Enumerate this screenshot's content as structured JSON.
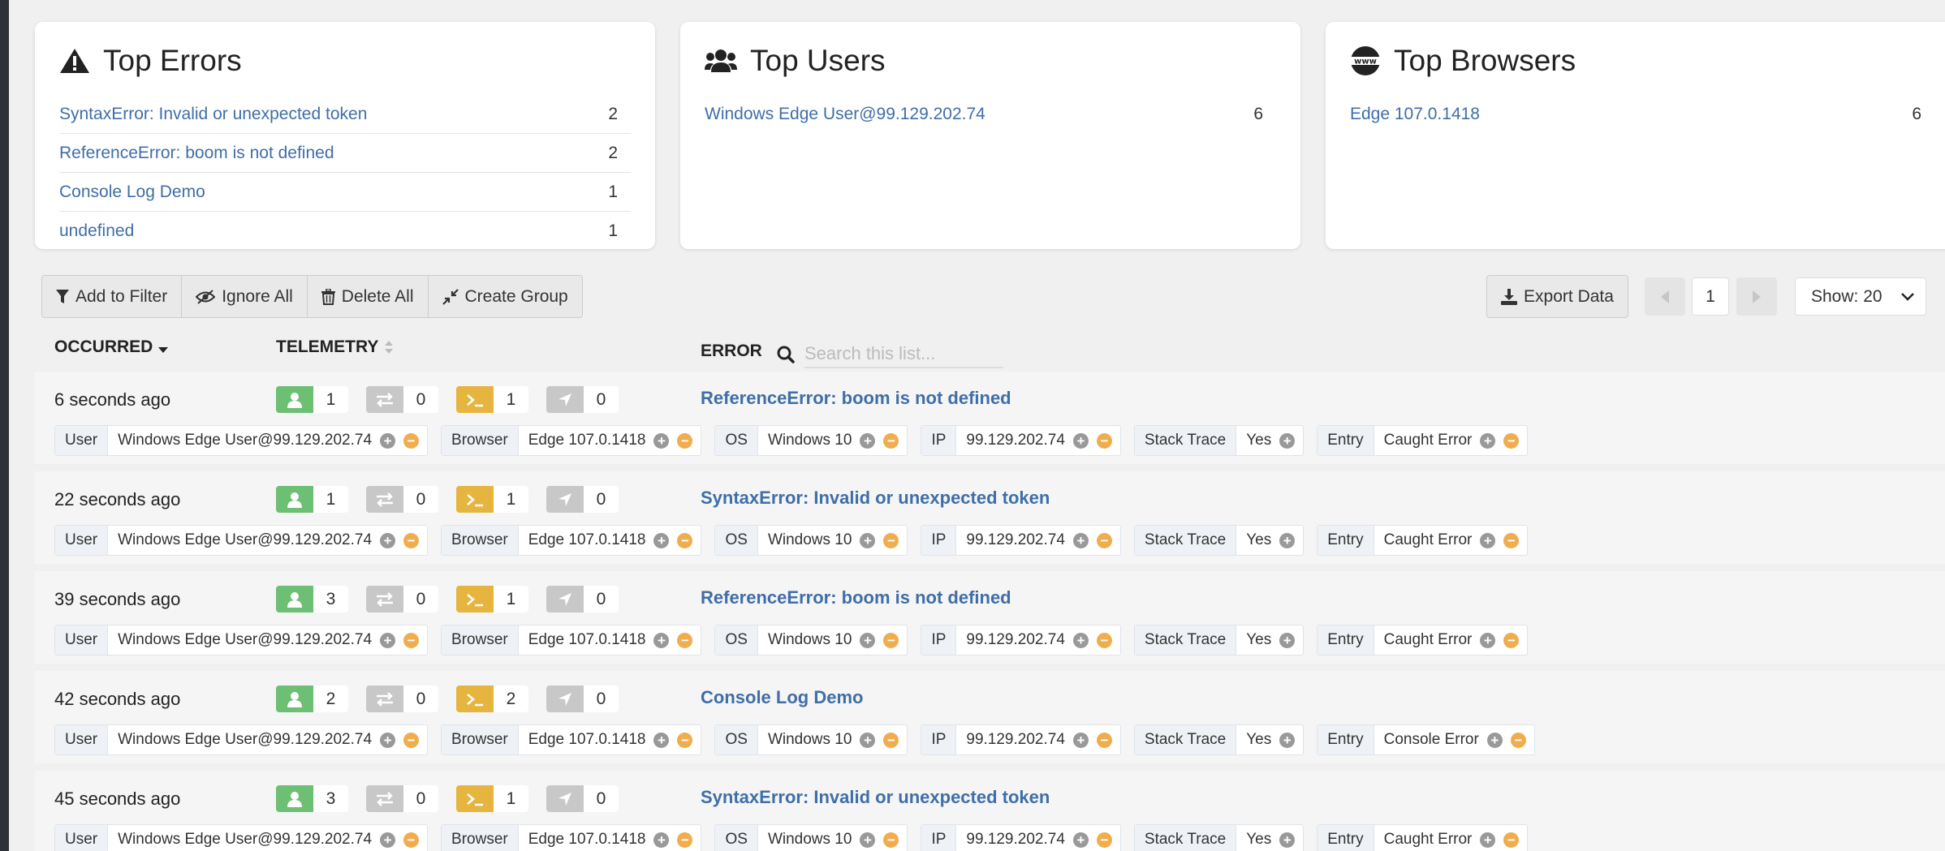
{
  "colors": {
    "link": "#3f6ea8",
    "user_badge": "#6cbf73",
    "nav_badge": "#c8c8c8",
    "console_badge": "#e6b540",
    "location_badge": "#c8c8c8",
    "minus": "#f0ad4e",
    "plus": "#999999"
  },
  "top_errors": {
    "title": "Top Errors",
    "icon": "warning-icon",
    "items": [
      {
        "label": "SyntaxError: Invalid or unexpected token",
        "count": "2"
      },
      {
        "label": "ReferenceError: boom is not defined",
        "count": "2"
      },
      {
        "label": "Console Log Demo",
        "count": "1"
      },
      {
        "label": "undefined",
        "count": "1"
      }
    ]
  },
  "top_users": {
    "title": "Top Users",
    "icon": "users-icon",
    "items": [
      {
        "label": "Windows Edge User@99.129.202.74",
        "count": "6"
      }
    ]
  },
  "top_browsers": {
    "title": "Top Browsers",
    "icon": "www-globe-icon",
    "items": [
      {
        "label": "Edge 107.0.1418",
        "count": "6"
      }
    ]
  },
  "toolbar": {
    "add_filter": "Add to Filter",
    "ignore_all": "Ignore All",
    "delete_all": "Delete All",
    "create_group": "Create Group",
    "export": "Export Data",
    "page": "1",
    "show": "Show: 20"
  },
  "table": {
    "col_occurred": "OCCURRED",
    "col_telemetry": "TELEMETRY",
    "col_error": "ERROR",
    "search_placeholder": "Search this list..."
  },
  "rows": [
    {
      "time": "6 seconds ago",
      "telemetry": [
        "1",
        "0",
        "1",
        "0"
      ],
      "error": "ReferenceError: boom is not defined",
      "tags": [
        {
          "k": "User",
          "v": "Windows Edge User@99.129.202.74",
          "minus": true
        },
        {
          "k": "Browser",
          "v": "Edge 107.0.1418",
          "minus": true
        },
        {
          "k": "OS",
          "v": "Windows 10",
          "minus": true
        },
        {
          "k": "IP",
          "v": "99.129.202.74",
          "minus": true
        },
        {
          "k": "Stack Trace",
          "v": "Yes",
          "minus": false
        },
        {
          "k": "Entry",
          "v": "Caught Error",
          "minus": true
        }
      ]
    },
    {
      "time": "22 seconds ago",
      "telemetry": [
        "1",
        "0",
        "1",
        "0"
      ],
      "error": "SyntaxError: Invalid or unexpected token",
      "tags": [
        {
          "k": "User",
          "v": "Windows Edge User@99.129.202.74",
          "minus": true
        },
        {
          "k": "Browser",
          "v": "Edge 107.0.1418",
          "minus": true
        },
        {
          "k": "OS",
          "v": "Windows 10",
          "minus": true
        },
        {
          "k": "IP",
          "v": "99.129.202.74",
          "minus": true
        },
        {
          "k": "Stack Trace",
          "v": "Yes",
          "minus": false
        },
        {
          "k": "Entry",
          "v": "Caught Error",
          "minus": true
        }
      ]
    },
    {
      "time": "39 seconds ago",
      "telemetry": [
        "3",
        "0",
        "1",
        "0"
      ],
      "error": "ReferenceError: boom is not defined",
      "tags": [
        {
          "k": "User",
          "v": "Windows Edge User@99.129.202.74",
          "minus": true
        },
        {
          "k": "Browser",
          "v": "Edge 107.0.1418",
          "minus": true
        },
        {
          "k": "OS",
          "v": "Windows 10",
          "minus": true
        },
        {
          "k": "IP",
          "v": "99.129.202.74",
          "minus": true
        },
        {
          "k": "Stack Trace",
          "v": "Yes",
          "minus": false
        },
        {
          "k": "Entry",
          "v": "Caught Error",
          "minus": true
        }
      ]
    },
    {
      "time": "42 seconds ago",
      "telemetry": [
        "2",
        "0",
        "2",
        "0"
      ],
      "error": "Console Log Demo",
      "tags": [
        {
          "k": "User",
          "v": "Windows Edge User@99.129.202.74",
          "minus": true
        },
        {
          "k": "Browser",
          "v": "Edge 107.0.1418",
          "minus": true
        },
        {
          "k": "OS",
          "v": "Windows 10",
          "minus": true
        },
        {
          "k": "IP",
          "v": "99.129.202.74",
          "minus": true
        },
        {
          "k": "Stack Trace",
          "v": "Yes",
          "minus": false
        },
        {
          "k": "Entry",
          "v": "Console Error",
          "minus": true
        }
      ]
    },
    {
      "time": "45 seconds ago",
      "telemetry": [
        "3",
        "0",
        "1",
        "0"
      ],
      "error": "SyntaxError: Invalid or unexpected token",
      "tags": [
        {
          "k": "User",
          "v": "Windows Edge User@99.129.202.74",
          "minus": true
        },
        {
          "k": "Browser",
          "v": "Edge 107.0.1418",
          "minus": true
        },
        {
          "k": "OS",
          "v": "Windows 10",
          "minus": true
        },
        {
          "k": "IP",
          "v": "99.129.202.74",
          "minus": true
        },
        {
          "k": "Stack Trace",
          "v": "Yes",
          "minus": false
        },
        {
          "k": "Entry",
          "v": "Caught Error",
          "minus": true
        }
      ]
    }
  ]
}
